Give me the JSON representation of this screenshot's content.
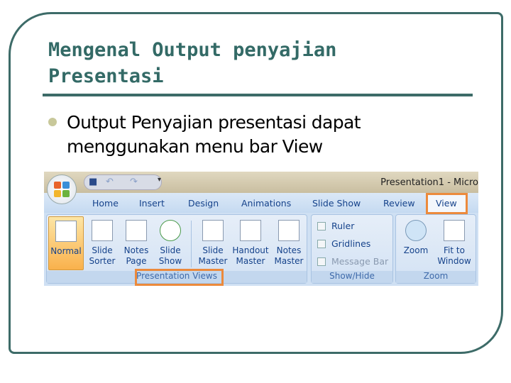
{
  "slide": {
    "title_line1": "Mengenal Output penyajian",
    "title_line2": "Presentasi",
    "bullet_line1": "Output Penyajian presentasi dapat",
    "bullet_line2": "menggunakan menu bar View"
  },
  "ribbon": {
    "window_title": "Presentation1 - Micro",
    "tabs": [
      "Home",
      "Insert",
      "Design",
      "Animations",
      "Slide Show",
      "Review",
      "View"
    ],
    "active_tab": "View",
    "groups": {
      "presentation_views": {
        "label": "Presentation Views",
        "buttons": [
          [
            "Normal",
            ""
          ],
          [
            "Slide",
            "Sorter"
          ],
          [
            "Notes",
            "Page"
          ],
          [
            "Slide",
            "Show"
          ],
          [
            "Slide",
            "Master"
          ],
          [
            "Handout",
            "Master"
          ],
          [
            "Notes",
            "Master"
          ]
        ]
      },
      "show_hide": {
        "label": "Show/Hide",
        "checkboxes": [
          "Ruler",
          "Gridlines",
          "Message Bar"
        ]
      },
      "zoom": {
        "label": "Zoom",
        "buttons": [
          [
            "Zoom",
            ""
          ],
          [
            "Fit to",
            "Window"
          ]
        ]
      }
    },
    "highlight_color": "#ec8a3c"
  }
}
